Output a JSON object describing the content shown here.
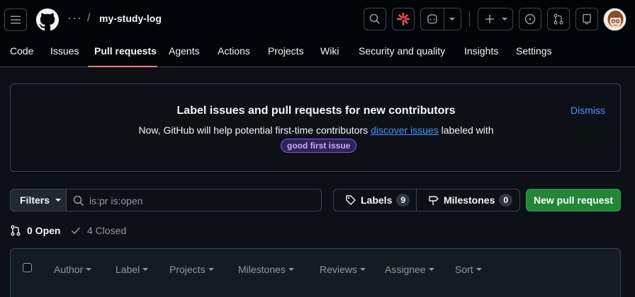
{
  "header": {
    "repo_name": "my-study-log",
    "breadcrumb_more": "···",
    "breadcrumb_separator": "/"
  },
  "tabs": [
    {
      "label": "Code"
    },
    {
      "label": "Issues"
    },
    {
      "label": "Pull requests",
      "active": true
    },
    {
      "label": "Agents"
    },
    {
      "label": "Actions"
    },
    {
      "label": "Projects"
    },
    {
      "label": "Wiki"
    },
    {
      "label": "Security and quality"
    },
    {
      "label": "Insights"
    },
    {
      "label": "Settings"
    }
  ],
  "banner": {
    "title": "Label issues and pull requests for new contributors",
    "text_before": "Now, GitHub will help potential first-time contributors ",
    "link": "discover issues",
    "text_after": " labeled with",
    "label": "good first issue",
    "dismiss": "Dismiss"
  },
  "toolbar": {
    "filters_label": "Filters",
    "search_placeholder": "is:pr is:open",
    "labels_label": "Labels",
    "labels_count": "9",
    "milestones_label": "Milestones",
    "milestones_count": "0",
    "new_pr_label": "New pull request"
  },
  "states": {
    "open": "0 Open",
    "closed": "4 Closed"
  },
  "list_header": {
    "columns": [
      "Author",
      "Label",
      "Projects",
      "Milestones",
      "Reviews",
      "Assignee",
      "Sort"
    ]
  },
  "colors": {
    "background": "#0d1117",
    "accent_underline": "#f78166",
    "link": "#4493f8",
    "primary_button": "#238636",
    "label_purple": "#d2a8ff"
  }
}
